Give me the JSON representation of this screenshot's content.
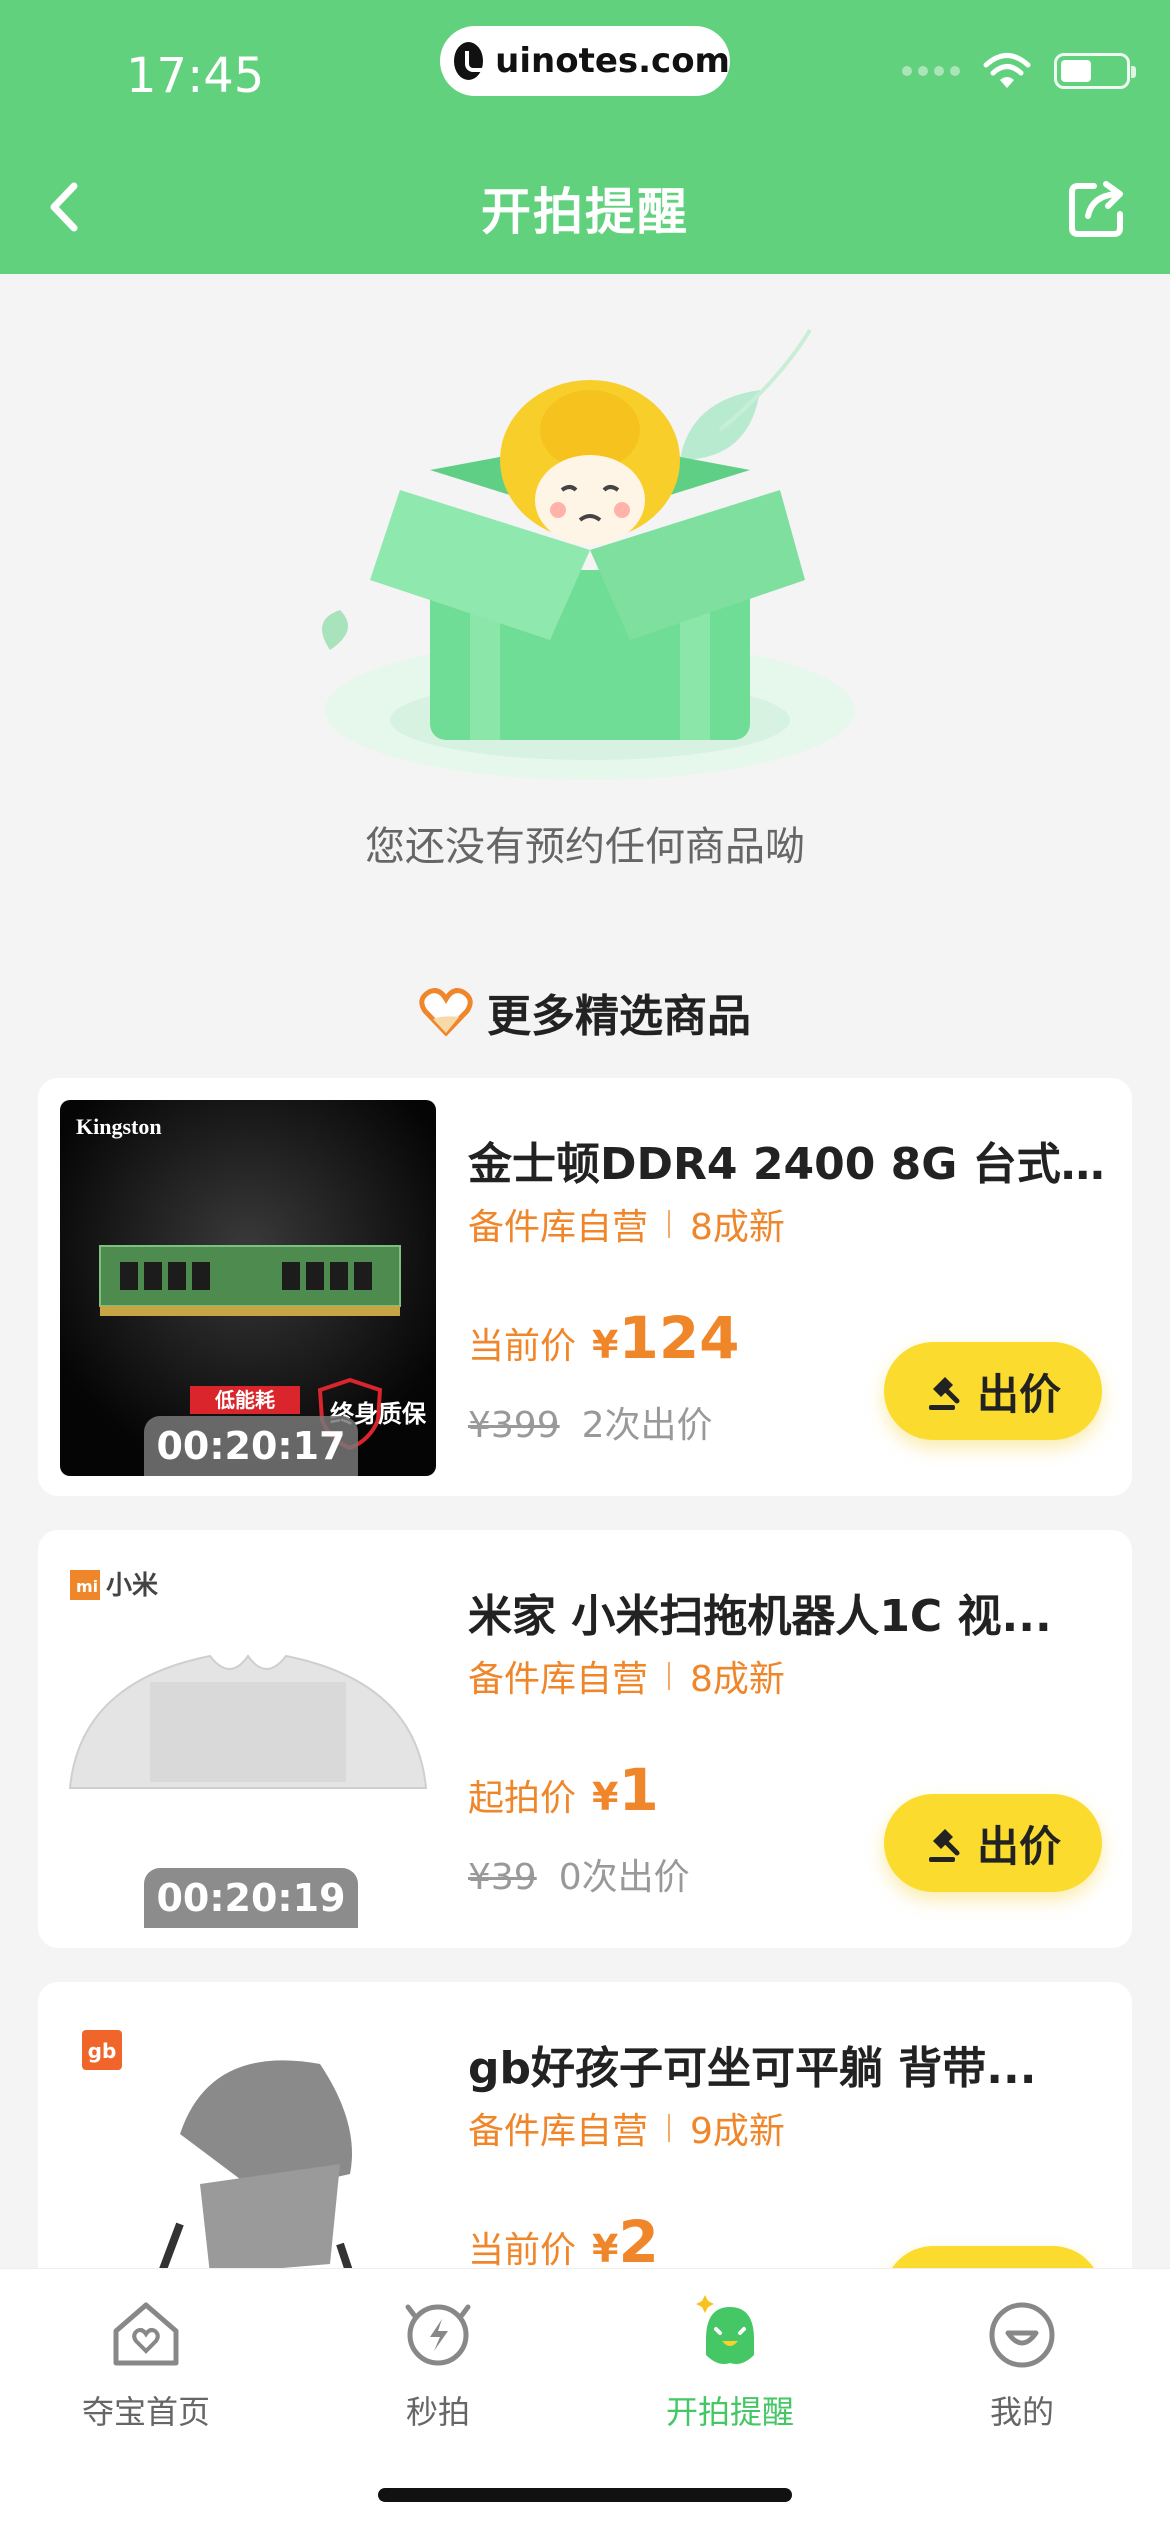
{
  "status_bar": {
    "time": "17:45",
    "url": "uinotes.com"
  },
  "header": {
    "title": "开拍提醒"
  },
  "empty_state": {
    "message": "您还没有预约任何商品呦"
  },
  "section": {
    "title": "更多精选商品"
  },
  "products": [
    {
      "title": "金士顿DDR4 2400 8G 台式...",
      "tag1": "备件库自营",
      "tag2": "8成新",
      "price_label": "当前价",
      "price_symbol": "¥",
      "price": "124",
      "original_price": "¥399",
      "bids": "2次出价",
      "bid_button": "出价",
      "countdown": "00:20:17",
      "image_brand": "Kingston",
      "image_badge1": "低能耗",
      "image_badge2": "终身质保"
    },
    {
      "title": "米家 小米扫拖机器人1C 视...",
      "tag1": "备件库自营",
      "tag2": "8成新",
      "price_label": "起拍价",
      "price_symbol": "¥",
      "price": "1",
      "original_price": "¥39",
      "bids": "0次出价",
      "bid_button": "出价",
      "countdown": "00:20:19",
      "image_brand": "小米"
    },
    {
      "title": "gb好孩子可坐可平躺 背带...",
      "tag1": "备件库自营",
      "tag2": "9成新",
      "price_label": "当前价",
      "price_symbol": "¥",
      "price": "2",
      "image_brand": "gb"
    }
  ],
  "tabbar": {
    "tabs": [
      {
        "label": "夺宝首页",
        "icon": "home-heart-icon"
      },
      {
        "label": "秒拍",
        "icon": "lightning-clock-icon"
      },
      {
        "label": "开拍提醒",
        "icon": "reminder-mascot-icon",
        "active": true
      },
      {
        "label": "我的",
        "icon": "profile-smile-icon"
      }
    ]
  },
  "colors": {
    "brand_green": "#62d17d",
    "accent_orange": "#f0862a",
    "button_yellow": "#fbdc2e",
    "tab_active": "#45c766"
  }
}
